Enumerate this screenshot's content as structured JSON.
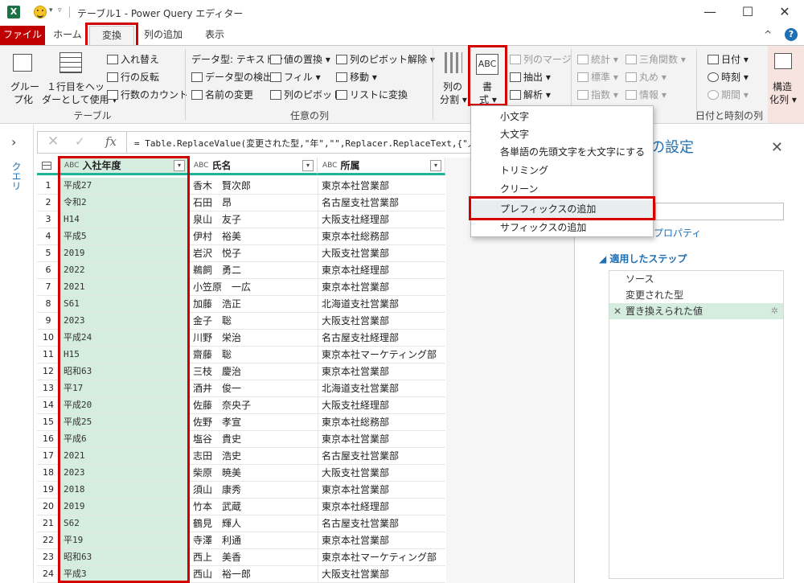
{
  "titlebar": {
    "app_letter": "X",
    "title": "テーブル1 - Power Query エディター",
    "minimize": "—",
    "maximize": "☐",
    "close": "✕"
  },
  "tabs": {
    "file": "ファイル",
    "home": "ホーム",
    "transform": "変換",
    "add_column": "列の追加",
    "view": "表示",
    "collapse": "^",
    "help": "?"
  },
  "ribbon": {
    "table_group": {
      "group_by": [
        "グルー",
        "プ化"
      ],
      "use_first_row": [
        "１行目をヘッ",
        "ダーとして使用 ▾"
      ],
      "transpose": "入れ替え",
      "reverse_rows": "行の反転",
      "count_rows": "行数のカウント",
      "label": "テーブル"
    },
    "any_column_group": {
      "data_type": "データ型: テキスト ▾",
      "detect_type": "データ型の検出",
      "rename": "名前の変更",
      "replace_values": "値の置換 ▾",
      "fill": "フィル ▾",
      "pivot": "列のピボット",
      "unpivot": "列のピボット解除 ▾",
      "move": "移動 ▾",
      "to_list": "リストに変換",
      "label": "任意の列"
    },
    "text_group": {
      "split": [
        "列の",
        "分割 ▾"
      ],
      "format": [
        "書",
        "式 ▾"
      ],
      "merge": "列のマージ",
      "extract": "抽出 ▾",
      "parse": "解析 ▾"
    },
    "number_group": {
      "statistics": "統計 ▾",
      "standard": "標準 ▾",
      "scientific": "指数 ▾",
      "trig": "三角関数 ▾",
      "rounding": "丸め ▾",
      "information": "情報 ▾"
    },
    "datetime_group": {
      "date": "日付 ▾",
      "time": "時刻 ▾",
      "duration": "期間 ▾",
      "label": "日付と時刻の列"
    },
    "structured_group": {
      "structured": [
        "構造",
        "化列 ▾"
      ]
    }
  },
  "leftnav": {
    "label": "クエリ",
    "expand": "›"
  },
  "formula_bar": {
    "cancel": "✕",
    "commit": "✓",
    "fx": "fx",
    "text": "= Table.ReplaceValue(変更された型,\"年\",\"\",Replacer.ReplaceText,{\"入社年度\"})"
  },
  "grid": {
    "col_type": "ABC",
    "columns": [
      "入社年度",
      "氏名",
      "所属"
    ],
    "rows": [
      [
        "1",
        "平成27",
        "香木　賢次郎",
        "東京本社営業部"
      ],
      [
        "2",
        "令和2",
        "石田　昂",
        "名古屋支社営業部"
      ],
      [
        "3",
        "H14",
        "泉山　友子",
        "大阪支社経理部"
      ],
      [
        "4",
        "平成5",
        "伊村　裕美",
        "東京本社総務部"
      ],
      [
        "5",
        "2019",
        "岩沢　悦子",
        "大阪支社営業部"
      ],
      [
        "6",
        "2022",
        "鵜飼　勇二",
        "東京本社経理部"
      ],
      [
        "7",
        "2021",
        "小笠原　一広",
        "東京本社営業部"
      ],
      [
        "8",
        "S61",
        "加藤　浩正",
        "北海道支社営業部"
      ],
      [
        "9",
        "2023",
        "金子　聡",
        "大阪支社営業部"
      ],
      [
        "10",
        "平成24",
        "川野　栄治",
        "名古屋支社経理部"
      ],
      [
        "11",
        "H15",
        "齋藤　聡",
        "東京本社マーケティング部"
      ],
      [
        "12",
        "昭和63",
        "三枝　慶治",
        "東京本社営業部"
      ],
      [
        "13",
        "平17",
        "酒井　俊一",
        "北海道支社営業部"
      ],
      [
        "14",
        "平成20",
        "佐藤　奈央子",
        "大阪支社経理部"
      ],
      [
        "15",
        "平成25",
        "佐野　孝宣",
        "東京本社総務部"
      ],
      [
        "16",
        "平成6",
        "塩谷　貴史",
        "東京本社営業部"
      ],
      [
        "17",
        "2021",
        "志田　浩史",
        "名古屋支社営業部"
      ],
      [
        "18",
        "2023",
        "柴原　暁美",
        "大阪支社営業部"
      ],
      [
        "19",
        "2018",
        "須山　康秀",
        "東京本社営業部"
      ],
      [
        "20",
        "2019",
        "竹本　武蔵",
        "東京本社経理部"
      ],
      [
        "21",
        "S62",
        "鶴見　輝人",
        "名古屋支社営業部"
      ],
      [
        "22",
        "平19",
        "寺澤　利通",
        "東京本社営業部"
      ],
      [
        "23",
        "昭和63",
        "西上　美香",
        "東京本社マーケティング部"
      ],
      [
        "24",
        "平成3",
        "西山　裕一郎",
        "大阪支社営業部"
      ]
    ]
  },
  "query_settings": {
    "title": "の設定",
    "close": "✕",
    "properties_link": "プロパティ",
    "applied_steps_title": "適用したステップ",
    "steps": [
      "ソース",
      "変更された型",
      "置き換えられた値"
    ],
    "step_delete": "✕",
    "step_gear": "✲"
  },
  "format_menu": {
    "items": [
      "小文字",
      "大文字",
      "各単語の先頭文字を大文字にする",
      "トリミング",
      "クリーン",
      "プレフィックスの追加",
      "サフィックスの追加"
    ],
    "highlighted_index": 5
  },
  "colors": {
    "accent_red": "#d40000",
    "file_tab": "#c00000",
    "selected_column": "#d4eddf",
    "header_underline": "#1fb39a",
    "link_blue": "#1f6fb2"
  }
}
